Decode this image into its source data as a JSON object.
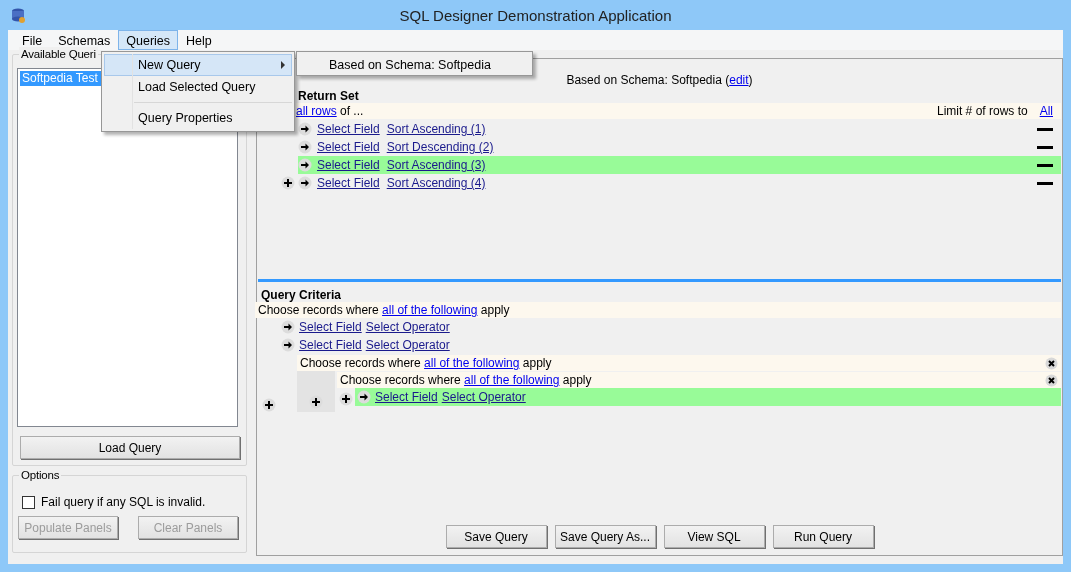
{
  "window": {
    "title": "SQL Designer Demonstration Application"
  },
  "menu_bar": [
    {
      "label": "File",
      "selected": false
    },
    {
      "label": "Schemas",
      "selected": false
    },
    {
      "label": "Queries",
      "selected": true
    },
    {
      "label": "Help",
      "selected": false
    }
  ],
  "queries_menu": [
    {
      "kind": "item",
      "label": "New Query",
      "highlighted": true,
      "has_submenu": true
    },
    {
      "kind": "item",
      "label": "Load Selected Query",
      "highlighted": false,
      "has_submenu": false
    },
    {
      "kind": "separator"
    },
    {
      "kind": "item",
      "label": "Query Properties",
      "highlighted": false,
      "has_submenu": false
    }
  ],
  "submenu": [
    {
      "label": "Based on Schema: Softpedia"
    }
  ],
  "available_queries": {
    "title": "Available Queri",
    "items": [
      {
        "label": "Softpedia Test",
        "selected": true
      }
    ],
    "button": "Load Query"
  },
  "options": {
    "title": "Options",
    "checkbox": {
      "label": "Fail query if any SQL is invalid.",
      "checked": false
    },
    "buttons": [
      {
        "label": "Populate Panels",
        "disabled": true
      },
      {
        "label": "Clear Panels",
        "disabled": true
      }
    ]
  },
  "schema_line": {
    "text": "Based on Schema: Softpedia (",
    "link": "edit",
    "suffix": ")"
  },
  "return_set": {
    "title": "Return Set",
    "scope_link": "all rows",
    "scope_suffix": "of ...",
    "limit_label": "Limit # of rows to",
    "limit_link": "All",
    "rows": [
      {
        "field": "Select Field",
        "sort": "Sort Ascending (1)",
        "highlighted": false
      },
      {
        "field": "Select Field",
        "sort": "Sort Descending (2)",
        "highlighted": false
      },
      {
        "field": "Select Field",
        "sort": "Sort Ascending (3)",
        "highlighted": true
      },
      {
        "field": "Select Field",
        "sort": "Sort Ascending (4)",
        "highlighted": false
      }
    ]
  },
  "criteria": {
    "title": "Query Criteria",
    "group": {
      "prefix": "Choose records where",
      "link": "all of the following",
      "suffix": "apply",
      "children": [
        {
          "kind": "condition",
          "field": "Select Field",
          "operator": "Select Operator",
          "highlighted": false
        },
        {
          "kind": "condition",
          "field": "Select Field",
          "operator": "Select Operator",
          "highlighted": false
        },
        {
          "kind": "group",
          "prefix": "Choose records where",
          "link": "all of the following",
          "suffix": "apply",
          "children": [
            {
              "kind": "group",
              "prefix": "Choose records where",
              "link": "all of the following",
              "suffix": "apply",
              "children": [
                {
                  "kind": "condition",
                  "field": "Select Field",
                  "operator": "Select Operator",
                  "highlighted": true
                }
              ]
            }
          ]
        }
      ]
    }
  },
  "buttons": [
    {
      "label": "Save Query"
    },
    {
      "label": "Save Query As..."
    },
    {
      "label": "View SQL"
    },
    {
      "label": "Run Query"
    }
  ]
}
